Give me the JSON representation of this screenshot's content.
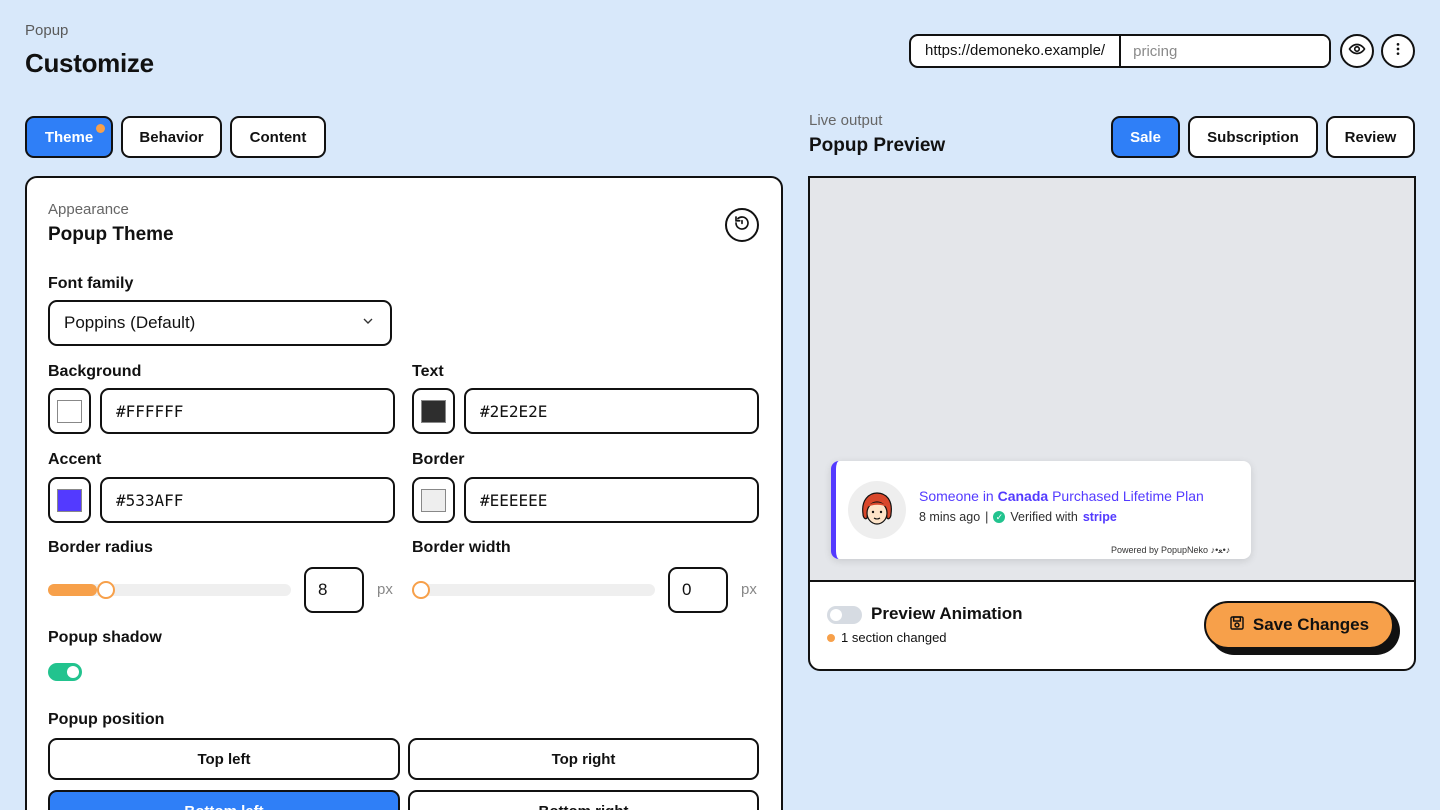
{
  "header": {
    "crumb": "Popup",
    "title": "Customize",
    "url_base": "https://demoneko.example/",
    "url_path_placeholder": "pricing"
  },
  "icons": {
    "preview": "eye-icon",
    "more": "more-vertical-icon",
    "reset": "reset-icon",
    "dropdown": "chevron-down-icon",
    "save": "save-icon"
  },
  "tabs": [
    {
      "label": "Theme",
      "active": true,
      "has_dot": true
    },
    {
      "label": "Behavior",
      "active": false
    },
    {
      "label": "Content",
      "active": false
    }
  ],
  "panel": {
    "kicker": "Appearance",
    "title": "Popup Theme",
    "font_family_label": "Font family",
    "font_family_value": "Poppins (Default)",
    "background_label": "Background",
    "background_value": "#FFFFFF",
    "text_label": "Text",
    "text_value": "#2E2E2E",
    "accent_label": "Accent",
    "accent_value": "#533AFF",
    "border_label": "Border",
    "border_value": "#EEEEEE",
    "border_radius_label": "Border radius",
    "border_radius_value": "8",
    "border_width_label": "Border width",
    "border_width_value": "0",
    "unit": "px",
    "shadow_label": "Popup shadow",
    "shadow_on": true,
    "position_label": "Popup position",
    "positions": [
      "Top left",
      "Top right",
      "Bottom left",
      "Bottom right"
    ],
    "selected_position": "Bottom left"
  },
  "sliders": {
    "border_radius_fraction": 0.2,
    "border_width_fraction": 0.0
  },
  "colors": {
    "background": "#FFFFFF",
    "text": "#2E2E2E",
    "accent": "#533AFF",
    "border": "#EEEEEE",
    "primary_button": "#2F7FF7",
    "save_button": "#F7A04A"
  },
  "preview": {
    "kicker": "Live output",
    "title": "Popup Preview",
    "tabs": [
      "Sale",
      "Subscription",
      "Review"
    ],
    "active_tab": "Sale",
    "popup_prefix": "Someone in",
    "popup_country": "Canada",
    "popup_suffix": "Purchased Lifetime Plan",
    "popup_time": "8 mins ago",
    "popup_separator": "|",
    "popup_verified": "Verified with",
    "popup_brand": "stripe",
    "powered_by": "Powered by PopupNeko ♪•ﻌ•♪",
    "animation_label": "Preview Animation",
    "changes": "1 section changed",
    "save_label": "Save Changes"
  }
}
